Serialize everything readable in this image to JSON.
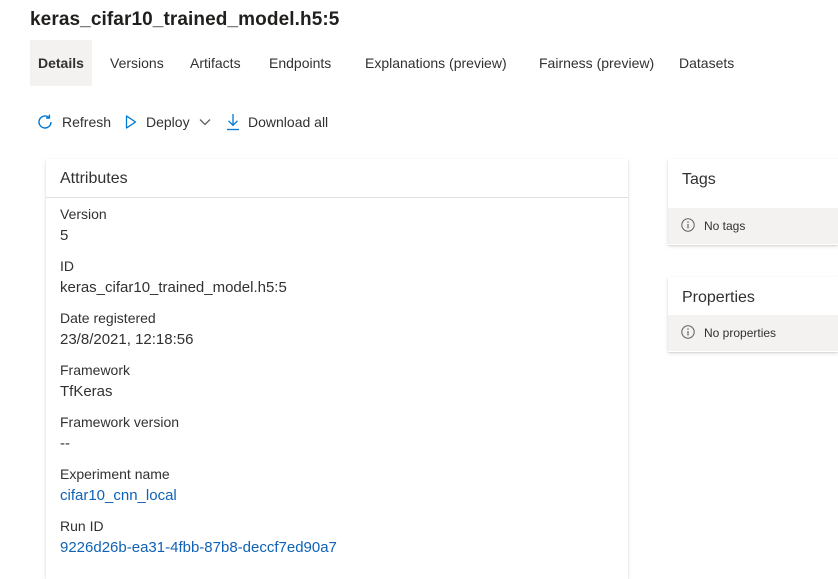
{
  "page": {
    "title": "keras_cifar10_trained_model.h5:5"
  },
  "tabs": [
    {
      "label": "Details",
      "active": true
    },
    {
      "label": "Versions"
    },
    {
      "label": "Artifacts"
    },
    {
      "label": "Endpoints"
    },
    {
      "label": "Explanations (preview)"
    },
    {
      "label": "Fairness (preview)"
    },
    {
      "label": "Datasets"
    }
  ],
  "toolbar": {
    "refresh_label": "Refresh",
    "deploy_label": "Deploy",
    "download_label": "Download all"
  },
  "attributes": {
    "header": "Attributes",
    "fields": [
      {
        "label": "Version",
        "value": "5"
      },
      {
        "label": "ID",
        "value": "keras_cifar10_trained_model.h5:5"
      },
      {
        "label": "Date registered",
        "value": "23/8/2021, 12:18:56"
      },
      {
        "label": "Framework",
        "value": "TfKeras"
      },
      {
        "label": "Framework version",
        "value": "--"
      },
      {
        "label": "Experiment name",
        "value": "cifar10_cnn_local",
        "link": true
      },
      {
        "label": "Run ID",
        "value": "9226d26b-ea31-4fbb-87b8-deccf7ed90a7",
        "link": true
      }
    ]
  },
  "tags": {
    "header": "Tags",
    "empty_text": "No tags"
  },
  "properties": {
    "header": "Properties",
    "empty_text": "No properties"
  },
  "colors": {
    "link": "#0f62b5",
    "tab_active_bg": "#f3f2f1",
    "icon_blue": "#0078d4"
  },
  "icons": {
    "refresh": "refresh-icon",
    "deploy": "play-outline-icon",
    "deploy_menu": "chevron-down-icon",
    "download": "download-icon",
    "info": "info-icon"
  }
}
